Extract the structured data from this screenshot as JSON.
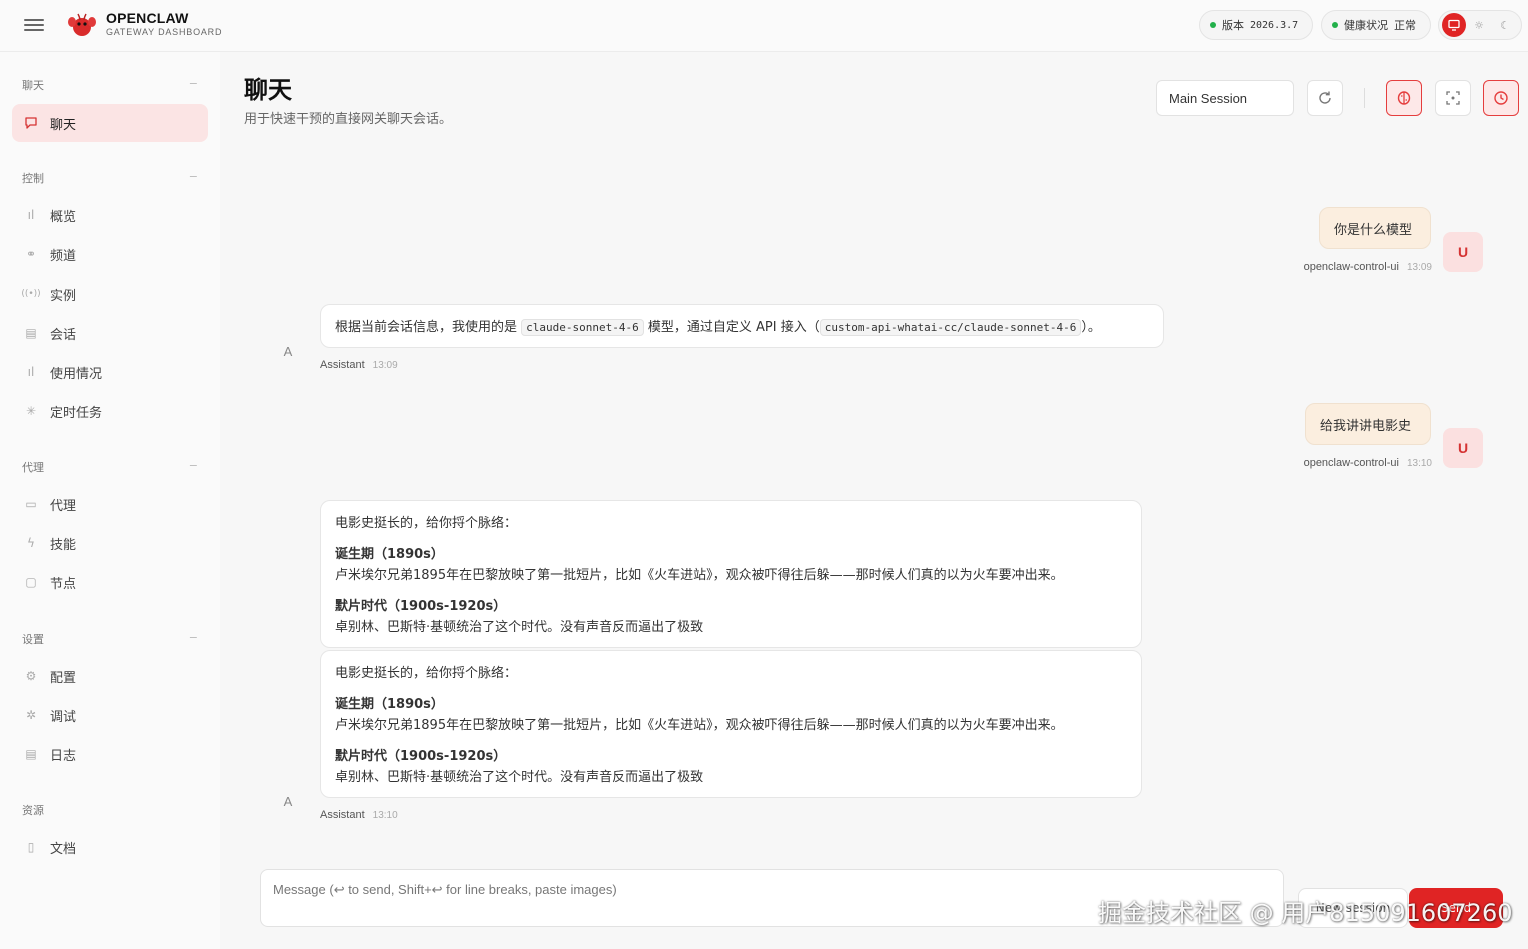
{
  "brand": {
    "title": "OPENCLAW",
    "subtitle": "GATEWAY DASHBOARD"
  },
  "status": {
    "version_label": "版本",
    "version_value": "2026.3.7",
    "health_label": "健康状况",
    "health_value": "正常"
  },
  "sidebar": {
    "sections": [
      {
        "title": "聊天",
        "items": [
          {
            "label": "聊天",
            "icon": "chat-icon",
            "active": true
          }
        ]
      },
      {
        "title": "控制",
        "items": [
          {
            "label": "概览",
            "icon": "bar-chart-icon"
          },
          {
            "label": "频道",
            "icon": "link-icon"
          },
          {
            "label": "实例",
            "icon": "broadcast-icon"
          },
          {
            "label": "会话",
            "icon": "document-icon"
          },
          {
            "label": "使用情况",
            "icon": "bar-chart-icon"
          },
          {
            "label": "定时任务",
            "icon": "loader-icon"
          }
        ]
      },
      {
        "title": "代理",
        "items": [
          {
            "label": "代理",
            "icon": "folder-icon"
          },
          {
            "label": "技能",
            "icon": "bolt-icon"
          },
          {
            "label": "节点",
            "icon": "monitor-icon"
          }
        ]
      },
      {
        "title": "设置",
        "items": [
          {
            "label": "配置",
            "icon": "gear-icon"
          },
          {
            "label": "调试",
            "icon": "bug-icon"
          },
          {
            "label": "日志",
            "icon": "log-icon"
          }
        ]
      },
      {
        "title": "资源",
        "items": [
          {
            "label": "文档",
            "icon": "book-icon"
          }
        ]
      }
    ]
  },
  "page": {
    "title": "聊天",
    "subtitle": "用于快速干预的直接网关聊天会话。"
  },
  "toolbar": {
    "session": "Main Session"
  },
  "messages": {
    "m1": {
      "text": "你是什么模型",
      "sender": "openclaw-control-ui",
      "time": "13:09",
      "avatar": "U"
    },
    "m2": {
      "avatar": "A",
      "sender": "Assistant",
      "time": "13:09",
      "pre": "根据当前会话信息，我使用的是",
      "code1": "claude-sonnet-4-6",
      "mid": "模型，通过自定义 API 接入（",
      "code2": "custom-api-whatai-cc/claude-sonnet-4-6",
      "post": "）。"
    },
    "m3": {
      "text": "给我讲讲电影史",
      "sender": "openclaw-control-ui",
      "time": "13:10",
      "avatar": "U"
    },
    "m4": {
      "avatar": "A",
      "sender": "Assistant",
      "time": "13:10",
      "intro": "电影史挺长的，给你捋个脉络：",
      "h1": "诞生期（1890s）",
      "p1": "卢米埃尔兄弟1895年在巴黎放映了第一批短片，比如《火车进站》，观众被吓得往后躲——那时候人们真的以为火车要冲出来。",
      "h2": "默片时代（1900s-1920s）",
      "p2": "卓别林、巴斯特·基顿统治了这个时代。没有声音反而逼出了极致"
    }
  },
  "composer": {
    "placeholder": "Message (↩ to send, Shift+↩ for line breaks, paste images)",
    "new_label": "New session",
    "send_label": "Send"
  },
  "watermark": "掘金技术社区 @ 用户815091607260"
}
